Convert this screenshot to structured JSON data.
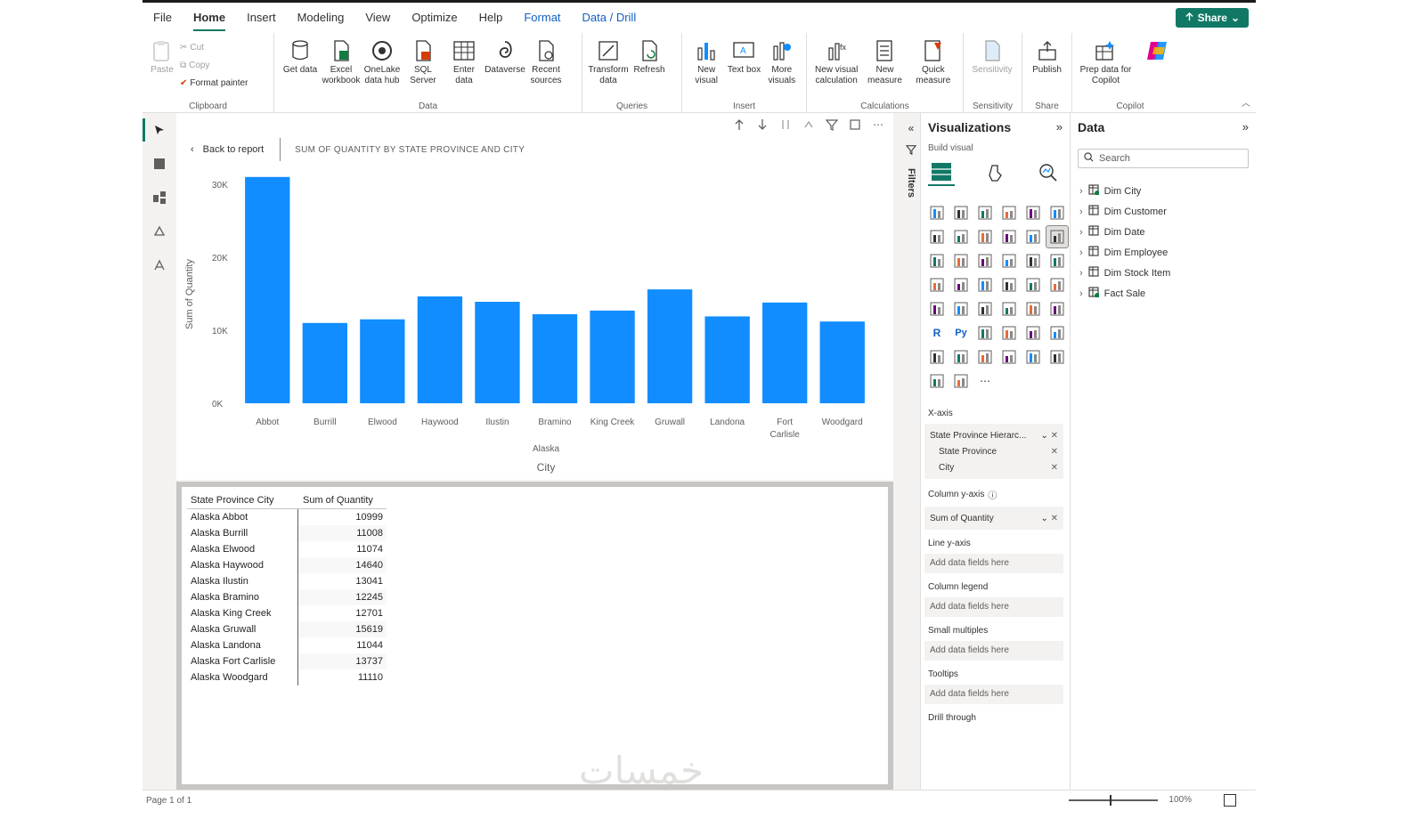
{
  "menu": {
    "items": [
      "File",
      "Home",
      "Insert",
      "Modeling",
      "View",
      "Optimize",
      "Help",
      "Format",
      "Data / Drill"
    ],
    "active_index": 1,
    "contextual_from": 7,
    "share_label": "Share"
  },
  "ribbon": {
    "clipboard": {
      "paste": "Paste",
      "cut": "Cut",
      "copy": "Copy",
      "format_painter": "Format painter",
      "label": "Clipboard"
    },
    "data": {
      "buttons": [
        "Get data",
        "Excel workbook",
        "OneLake data hub",
        "SQL Server",
        "Enter data",
        "Dataverse",
        "Recent sources"
      ],
      "label": "Data"
    },
    "queries": {
      "buttons": [
        "Transform data",
        "Refresh"
      ],
      "label": "Queries"
    },
    "insert": {
      "buttons": [
        "New visual",
        "Text box",
        "More visuals"
      ],
      "label": "Insert"
    },
    "calculations": {
      "buttons": [
        "New visual calculation",
        "New measure",
        "Quick measure"
      ],
      "label": "Calculations"
    },
    "sensitivity": {
      "buttons": [
        "Sensitivity"
      ],
      "label": "Sensitivity"
    },
    "share": {
      "buttons": [
        "Publish"
      ],
      "label": "Share"
    },
    "copilot": {
      "buttons": [
        "Prep data for Copilot",
        ""
      ],
      "label": "Copilot"
    }
  },
  "drill": {
    "back_label": "Back to report",
    "title": "SUM OF QUANTITY    BY STATE PROVINCE AND CITY"
  },
  "chart_data": {
    "type": "bar",
    "categories": [
      "Abbot",
      "Burrill",
      "Elwood",
      "Haywood",
      "Ilustin",
      "Bramino",
      "King Creek",
      "Gruwall",
      "Landona",
      "Fort Carlisle",
      "Woodgard"
    ],
    "category_group": "Alaska",
    "values": [
      31000,
      11000,
      11500,
      14640,
      13900,
      12200,
      12700,
      15600,
      11900,
      13800,
      11200
    ],
    "xlabel": "City",
    "ylabel": "Sum of Quantity",
    "yticks": [
      "0K",
      "10K",
      "20K",
      "30K"
    ],
    "ylim": [
      0,
      30000
    ],
    "bar_color": "#118dff"
  },
  "matrix": {
    "headers": [
      "State Province City",
      "Sum of Quantity"
    ],
    "rows": [
      [
        "Alaska Abbot",
        "10999"
      ],
      [
        "Alaska Burrill",
        "11008"
      ],
      [
        "Alaska Elwood",
        "11074"
      ],
      [
        "Alaska Haywood",
        "14640"
      ],
      [
        "Alaska Ilustin",
        "13041"
      ],
      [
        "Alaska Bramino",
        "12245"
      ],
      [
        "Alaska King Creek",
        "12701"
      ],
      [
        "Alaska Gruwall",
        "15619"
      ],
      [
        "Alaska Landona",
        "11044"
      ],
      [
        "Alaska Fort Carlisle",
        "13737"
      ],
      [
        "Alaska Woodgard",
        "11110"
      ]
    ]
  },
  "filters": {
    "label": "Filters"
  },
  "visualizations": {
    "title": "Visualizations",
    "build_label": "Build visual",
    "wells": {
      "xaxis_label": "X-axis",
      "xaxis_field": "State Province Hierarc...",
      "xaxis_sub": [
        "State Province",
        "City"
      ],
      "yaxis_label": "Column y-axis",
      "yaxis_field": "Sum of Quantity",
      "line_label": "Line y-axis",
      "legend_label": "Column legend",
      "small_label": "Small multiples",
      "tooltips_label": "Tooltips",
      "drill_label": "Drill through",
      "add_placeholder": "Add data fields here"
    }
  },
  "data_pane": {
    "title": "Data",
    "search_placeholder": "Search",
    "tables": [
      "Dim City",
      "Dim Customer",
      "Dim Date",
      "Dim Employee",
      "Dim Stock Item",
      "Fact Sale"
    ]
  },
  "status": {
    "page": "Page 1 of 1",
    "zoom": "100%"
  },
  "watermark": "خمسات",
  "colors": {
    "accent": "#117865",
    "bar": "#118dff"
  }
}
